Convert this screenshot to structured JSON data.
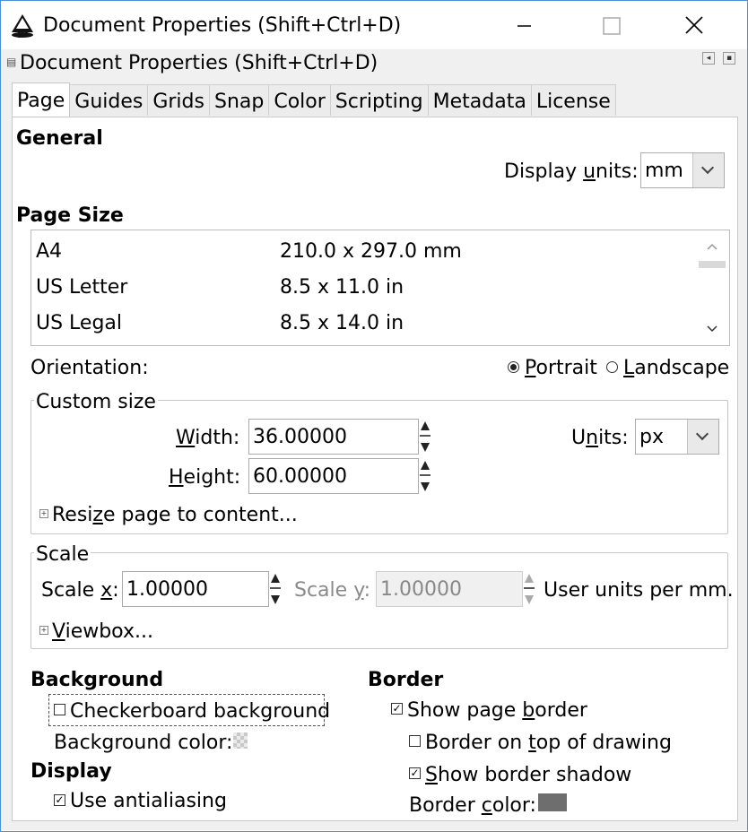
{
  "window": {
    "title": "Document Properties (Shift+Ctrl+D)",
    "minimize_icon": "minimize-icon",
    "maximize_icon": "maximize-icon",
    "close_icon": "close-icon"
  },
  "dock": {
    "title": "Document Properties (Shift+Ctrl+D)"
  },
  "tabs": [
    {
      "label": "Page",
      "active": true
    },
    {
      "label": "Guides",
      "active": false
    },
    {
      "label": "Grids",
      "active": false
    },
    {
      "label": "Snap",
      "active": false
    },
    {
      "label": "Color",
      "active": false
    },
    {
      "label": "Scripting",
      "active": false
    },
    {
      "label": "Metadata",
      "active": false
    },
    {
      "label": "License",
      "active": false
    }
  ],
  "general": {
    "heading": "General",
    "display_units_pre": "Display ",
    "display_units_u": "u",
    "display_units_post": "nits:",
    "display_units_value": "mm"
  },
  "page_size": {
    "heading": "Page Size",
    "rows": [
      {
        "name": "A4",
        "size": "210.0 x 297.0 mm"
      },
      {
        "name": "US Letter",
        "size": "8.5 x 11.0 in"
      },
      {
        "name": "US Legal",
        "size": "8.5 x 14.0 in"
      }
    ]
  },
  "orientation": {
    "label": "Orientation:",
    "portrait_u": "P",
    "portrait_rest": "ortrait",
    "landscape_u": "L",
    "landscape_rest": "andscape",
    "selected": "portrait"
  },
  "custom_size": {
    "legend": "Custom size",
    "width_u": "W",
    "width_rest": "idth:",
    "width_value": "36.00000",
    "height_u": "H",
    "height_rest": "eight:",
    "height_value": "60.00000",
    "units_pre": "U",
    "units_u": "n",
    "units_post": "its:",
    "units_value": "px",
    "resize_pre": "Resi",
    "resize_u": "z",
    "resize_post": "e page to content..."
  },
  "scale": {
    "legend": "Scale",
    "scale_x_pre": "Scale ",
    "scale_x_u": "x",
    "scale_x_post": ":",
    "scale_x_value": "1.00000",
    "scale_y_pre": "Scale ",
    "scale_y_u": "y",
    "scale_y_post": ":",
    "scale_y_value": "1.00000",
    "user_units": "User units per mm.",
    "viewbox_u": "V",
    "viewbox_rest": "iewbox..."
  },
  "background": {
    "heading": "Background",
    "checkerboard": "Checkerboard background",
    "checkerboard_checked": false,
    "color_label": "Background color:"
  },
  "display": {
    "heading": "Display",
    "antialiasing": "Use antialiasing",
    "antialiasing_checked": true
  },
  "border": {
    "heading": "Border",
    "show_pre": "Show page ",
    "show_u": "b",
    "show_post": "order",
    "show_checked": true,
    "top_pre": "Border on ",
    "top_u": "t",
    "top_post": "op of drawing",
    "top_checked": false,
    "shadow_u": "S",
    "shadow_rest": "how border shadow",
    "shadow_checked": true,
    "color_pre": "Border ",
    "color_u": "c",
    "color_post": "olor:",
    "color_hex": "#6e6e6e"
  }
}
